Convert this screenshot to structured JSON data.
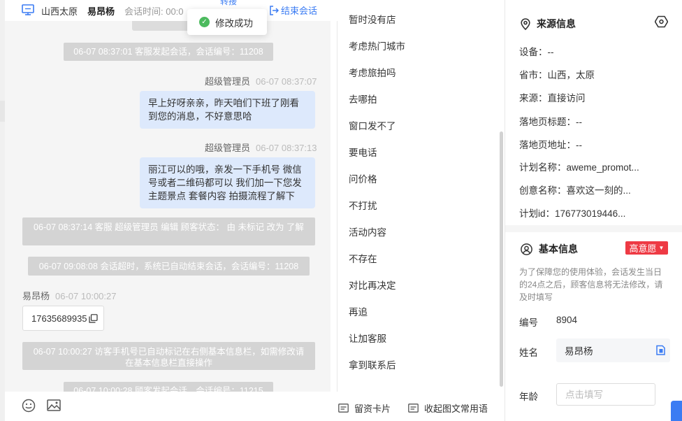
{
  "header": {
    "region": "山西太原",
    "visitor_name": "易昂杨",
    "session_time_label": "会话时间: 00:0",
    "hidden_link": "转接",
    "end_session": "结束会话"
  },
  "toast": {
    "text": "修改成功",
    "icon": "check-circle-icon"
  },
  "messages": {
    "sys1": "06-07 08:37:01 客服发起会话，会话编号：11208",
    "msg1_sender": "超级管理员",
    "msg1_time": "06-07 08:37:07",
    "msg1_text": "早上好呀亲亲，昨天咱们下班了刚看到您的消息，不好意思哈",
    "msg2_sender": "超级管理员",
    "msg2_time": "06-07 08:37:13",
    "msg2_text": "丽江可以的哦，亲发一下手机号 微信号或者二维码都可以 我们加一下您发主题景点 套餐内容 拍摄流程了解下",
    "sys2": "06-07 08:37:14 客服 超级管理员 编辑 顾客状态： 由 未标记 改为 了解",
    "sys3": "06-07 09:08:08 会话超时，系统已自动结束会话，会话编号：11208",
    "visitor_sender": "易昂杨",
    "visitor_time": "06-07 10:00:27",
    "visitor_phone": "17635689935",
    "sys4": "06-07 10:00:27 访客手机号已自动标记在右侧基本信息栏，如需修改请在基本信息栏直接操作",
    "sys5": "06-07 10:00:28 顾客发起会话，会话编号：11215"
  },
  "chat_footer": {
    "emoji_icon": "smile-icon",
    "image_icon": "image-icon"
  },
  "phrases": {
    "items": [
      "暂时没有店",
      "考虑热门城市",
      "考虑旅拍吗",
      "去哪拍",
      "窗口发不了",
      "要电话",
      "问价格",
      "不打扰",
      "活动内容",
      "不存在",
      "对比再决定",
      "再追",
      "让加客服",
      "拿到联系后"
    ],
    "leave_card": "留资卡片",
    "common_text": "收起图文常用语"
  },
  "source": {
    "title": "来源信息",
    "device": "设备：--",
    "province": "省市：山西，太原",
    "origin": "来源：直接访问",
    "landing_title": "落地页标题：--",
    "landing_url": "落地页地址：--",
    "plan_name": "计划名称：aweme_promot...",
    "creative_name": "创意名称：喜欢这一刻的...",
    "plan_id": "计划id：176773019446..."
  },
  "basic": {
    "title": "基本信息",
    "intent_badge": "高意愿",
    "note": "为了保障您的使用体验，会话发生当日的24点之后，顾客信息将无法修改，请及时填写",
    "id_label": "编号",
    "id_value": "8904",
    "name_label": "姓名",
    "name_value": "易昂杨",
    "age_label": "年龄",
    "age_placeholder": "点击填写"
  },
  "colors": {
    "accent": "#3b7cf3",
    "bubble": "#dde9fc",
    "badge": "#ee3a44",
    "success": "#4cba5e"
  }
}
